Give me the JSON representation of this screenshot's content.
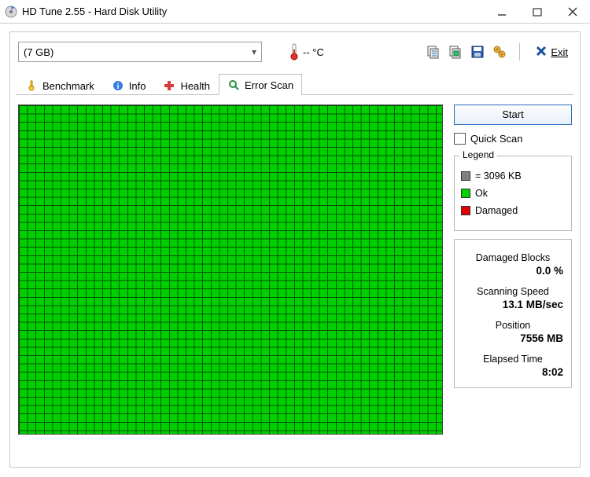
{
  "window": {
    "title": "HD Tune 2.55 - Hard Disk Utility"
  },
  "toolbar": {
    "drive_selected": "(7 GB)",
    "temperature": "-- °C",
    "exit_label": "Exit"
  },
  "tabs": [
    {
      "id": "benchmark",
      "label": "Benchmark",
      "active": false
    },
    {
      "id": "info",
      "label": "Info",
      "active": false
    },
    {
      "id": "health",
      "label": "Health",
      "active": false
    },
    {
      "id": "errorscan",
      "label": "Error Scan",
      "active": true
    }
  ],
  "errorscan": {
    "start_label": "Start",
    "quick_scan_label": "Quick Scan",
    "quick_scan_checked": false,
    "legend_title": "Legend",
    "legend_block_label": "= 3096 KB",
    "legend_ok_label": "Ok",
    "legend_damaged_label": "Damaged",
    "stats": {
      "damaged_blocks_label": "Damaged Blocks",
      "damaged_blocks_value": "0.0 %",
      "scanning_speed_label": "Scanning Speed",
      "scanning_speed_value": "13.1 MB/sec",
      "position_label": "Position",
      "position_value": "7556 MB",
      "elapsed_time_label": "Elapsed Time",
      "elapsed_time_value": "8:02"
    },
    "grid": {
      "cell_status": "all_ok"
    }
  }
}
